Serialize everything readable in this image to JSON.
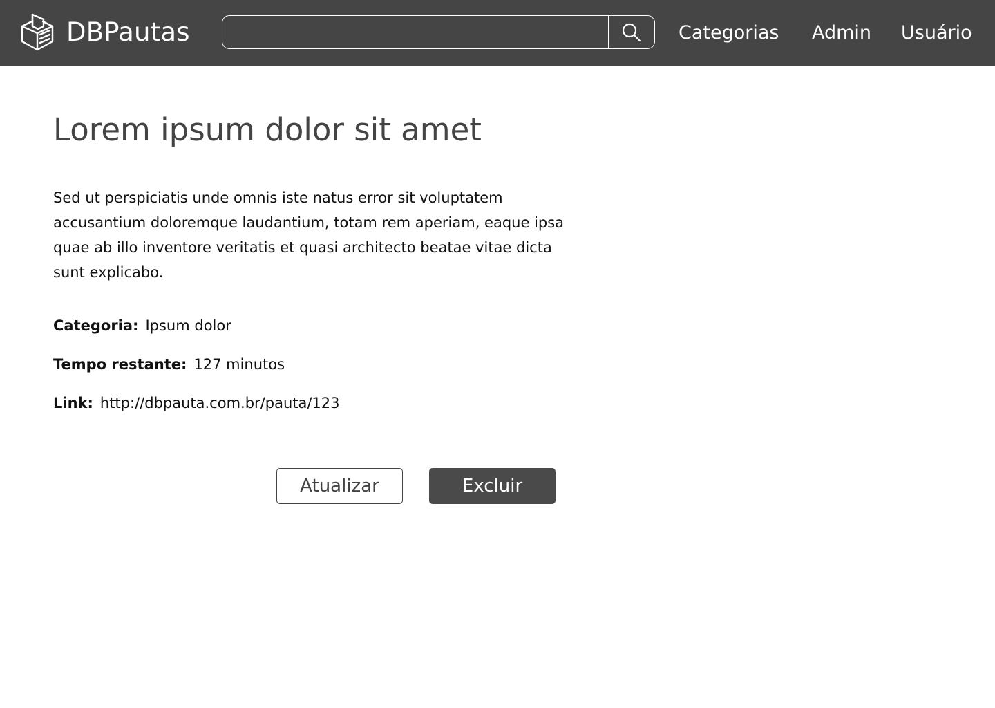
{
  "navbar": {
    "brand_name": "DBPautas",
    "search": {
      "value": "",
      "placeholder": ""
    },
    "links": {
      "categorias": "Categorias",
      "admin": "Admin",
      "usuario": "Usuário"
    },
    "background_color": "#454545"
  },
  "pauta": {
    "title": "Lorem ipsum dolor sit amet",
    "description": "Sed ut perspiciatis unde omnis iste natus error sit voluptatem accusantium doloremque laudantium, totam rem aperiam, eaque ipsa quae ab illo inventore veritatis et quasi architecto beatae vitae dicta sunt explicabo.",
    "categoria_label": "Categoria:",
    "categoria_value": "Ipsum dolor",
    "tempo_label": "Tempo restante:",
    "tempo_value": "127 minutos",
    "link_label": "Link:",
    "link_value": "http://dbpauta.com.br/pauta/123"
  },
  "actions": {
    "update_label": "Atualizar",
    "delete_label": "Excluir"
  },
  "icons": {
    "logo": "ballot-box-icon",
    "search": "search-icon"
  }
}
